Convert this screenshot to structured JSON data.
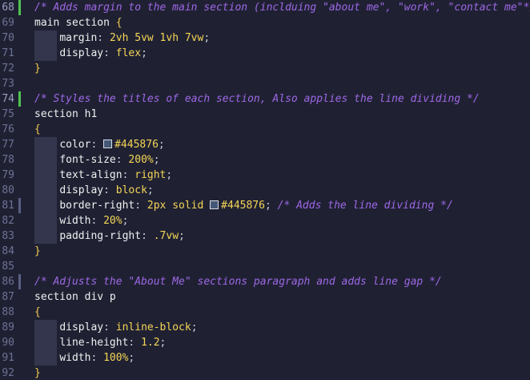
{
  "editor": {
    "language": "css",
    "colors": {
      "background": "#1f2133",
      "comment": "#9f68e6",
      "value": "#f5d556",
      "line_number": "#6d7293",
      "git_added": "#4fc44f"
    },
    "lines": [
      {
        "n": "68",
        "git": "added",
        "active": true,
        "indent": false,
        "tokens": [
          {
            "c": "comment",
            "t": "/* Adds margin to the main section (inclduing \"about me\", \"work\", \"contact me\"*/"
          }
        ]
      },
      {
        "n": "69",
        "git": "",
        "indent": false,
        "tokens": [
          {
            "c": "selector",
            "t": "main section "
          },
          {
            "c": "brace",
            "t": "{"
          }
        ]
      },
      {
        "n": "70",
        "git": "",
        "indent": true,
        "tokens": [
          {
            "c": "prop",
            "t": "margin"
          },
          {
            "c": "punct",
            "t": ": "
          },
          {
            "c": "value",
            "t": "2vh 5vw 1vh 7vw"
          },
          {
            "c": "punct",
            "t": ";"
          }
        ]
      },
      {
        "n": "71",
        "git": "",
        "indent": true,
        "tokens": [
          {
            "c": "prop",
            "t": "display"
          },
          {
            "c": "punct",
            "t": ": "
          },
          {
            "c": "value",
            "t": "flex"
          },
          {
            "c": "punct",
            "t": ";"
          }
        ]
      },
      {
        "n": "72",
        "git": "",
        "indent": false,
        "tokens": [
          {
            "c": "brace",
            "t": "}"
          }
        ]
      },
      {
        "n": "73",
        "git": "",
        "indent": false,
        "tokens": []
      },
      {
        "n": "74",
        "git": "added",
        "active": true,
        "indent": false,
        "tokens": [
          {
            "c": "comment",
            "t": "/* Styles the titles of each section, Also applies the line dividing */"
          }
        ]
      },
      {
        "n": "75",
        "git": "",
        "indent": false,
        "tokens": [
          {
            "c": "selector",
            "t": "section h1"
          }
        ]
      },
      {
        "n": "76",
        "git": "",
        "indent": false,
        "tokens": [
          {
            "c": "brace",
            "t": "{"
          }
        ]
      },
      {
        "n": "77",
        "git": "",
        "indent": true,
        "tokens": [
          {
            "c": "prop",
            "t": "color"
          },
          {
            "c": "punct",
            "t": ": "
          },
          {
            "c": "swatch",
            "t": "#445876"
          },
          {
            "c": "value",
            "t": "#445876"
          },
          {
            "c": "punct",
            "t": ";"
          }
        ]
      },
      {
        "n": "78",
        "git": "",
        "indent": true,
        "tokens": [
          {
            "c": "prop",
            "t": "font-size"
          },
          {
            "c": "punct",
            "t": ": "
          },
          {
            "c": "value",
            "t": "200%"
          },
          {
            "c": "punct",
            "t": ";"
          }
        ]
      },
      {
        "n": "79",
        "git": "",
        "indent": true,
        "tokens": [
          {
            "c": "prop",
            "t": "text-align"
          },
          {
            "c": "punct",
            "t": ": "
          },
          {
            "c": "value",
            "t": "right"
          },
          {
            "c": "punct",
            "t": ";"
          }
        ]
      },
      {
        "n": "80",
        "git": "",
        "indent": true,
        "tokens": [
          {
            "c": "prop",
            "t": "display"
          },
          {
            "c": "punct",
            "t": ": "
          },
          {
            "c": "value",
            "t": "block"
          },
          {
            "c": "punct",
            "t": ";"
          }
        ]
      },
      {
        "n": "81",
        "git": "modified",
        "indent": true,
        "tokens": [
          {
            "c": "prop",
            "t": "border-right"
          },
          {
            "c": "punct",
            "t": ": "
          },
          {
            "c": "value",
            "t": "2px solid "
          },
          {
            "c": "swatch",
            "t": "#445876"
          },
          {
            "c": "value",
            "t": "#445876"
          },
          {
            "c": "punct",
            "t": "; "
          },
          {
            "c": "comment",
            "t": "/* Adds the line dividing */"
          }
        ]
      },
      {
        "n": "82",
        "git": "",
        "indent": true,
        "tokens": [
          {
            "c": "prop",
            "t": "width"
          },
          {
            "c": "punct",
            "t": ": "
          },
          {
            "c": "value",
            "t": "20%"
          },
          {
            "c": "punct",
            "t": ";"
          }
        ]
      },
      {
        "n": "83",
        "git": "",
        "indent": true,
        "tokens": [
          {
            "c": "prop",
            "t": "padding-right"
          },
          {
            "c": "punct",
            "t": ": "
          },
          {
            "c": "value",
            "t": ".7vw"
          },
          {
            "c": "punct",
            "t": ";"
          }
        ]
      },
      {
        "n": "84",
        "git": "",
        "indent": false,
        "tokens": [
          {
            "c": "brace",
            "t": "}"
          }
        ]
      },
      {
        "n": "85",
        "git": "",
        "indent": false,
        "tokens": []
      },
      {
        "n": "86",
        "git": "modified",
        "indent": false,
        "tokens": [
          {
            "c": "comment",
            "t": "/* Adjusts the \"About Me\" sections paragraph and adds line gap */"
          }
        ]
      },
      {
        "n": "87",
        "git": "",
        "indent": false,
        "tokens": [
          {
            "c": "selector",
            "t": "section div p"
          }
        ]
      },
      {
        "n": "88",
        "git": "",
        "indent": false,
        "tokens": [
          {
            "c": "brace",
            "t": "{"
          }
        ]
      },
      {
        "n": "89",
        "git": "",
        "indent": true,
        "tokens": [
          {
            "c": "prop",
            "t": "display"
          },
          {
            "c": "punct",
            "t": ": "
          },
          {
            "c": "value",
            "t": "inline-block"
          },
          {
            "c": "punct",
            "t": ";"
          }
        ]
      },
      {
        "n": "90",
        "git": "",
        "indent": true,
        "tokens": [
          {
            "c": "prop",
            "t": "line-height"
          },
          {
            "c": "punct",
            "t": ": "
          },
          {
            "c": "value",
            "t": "1.2"
          },
          {
            "c": "punct",
            "t": ";"
          }
        ]
      },
      {
        "n": "91",
        "git": "",
        "indent": true,
        "tokens": [
          {
            "c": "prop",
            "t": "width"
          },
          {
            "c": "punct",
            "t": ": "
          },
          {
            "c": "value",
            "t": "100%"
          },
          {
            "c": "punct",
            "t": ";"
          }
        ]
      },
      {
        "n": "92",
        "git": "",
        "indent": false,
        "tokens": [
          {
            "c": "brace",
            "t": "}"
          }
        ]
      }
    ]
  }
}
